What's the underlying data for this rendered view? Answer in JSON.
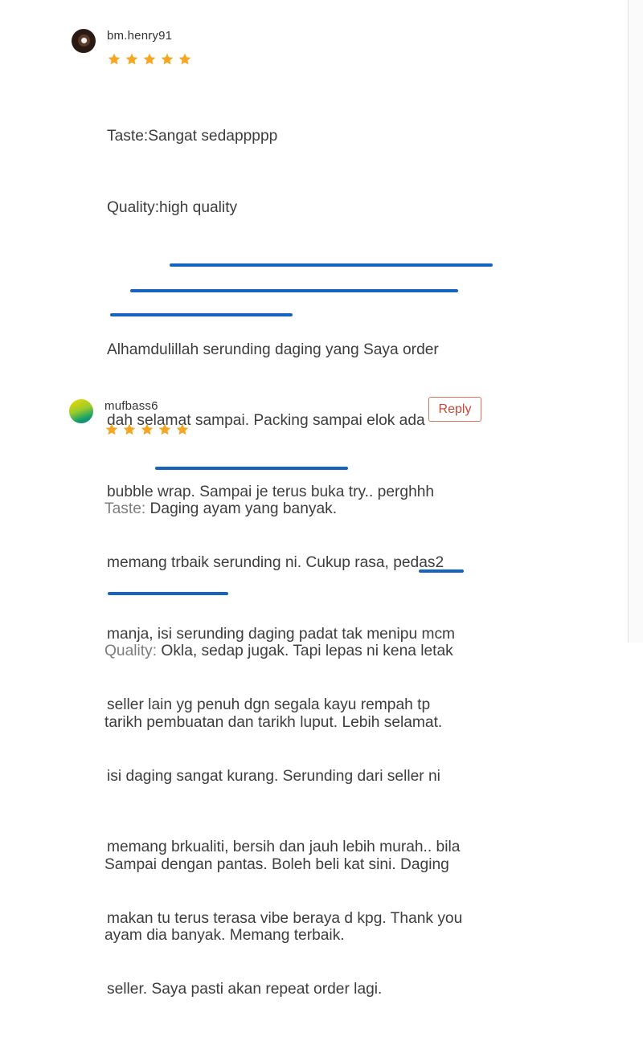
{
  "reviews": [
    {
      "username": "bm.henry91",
      "rating": 5,
      "lines": [
        "Taste:Sangat sedappppp",
        "Quality:high quality",
        "",
        "Alhamdulillah serunding daging yang Saya order",
        "dah selamat sampai. Packing sampai elok ada",
        "bubble wrap. Sampai je terus buka try.. perghhh",
        "memang trbaik serunding ni. Cukup rasa, pedas2",
        "manja, isi serunding daging padat tak menipu mcm",
        "seller lain yg penuh dgn segala kayu rempah tp",
        "isi daging sangat kurang. Serunding dari seller ni",
        "memang brkualiti, bersih dan jauh lebih murah.. bila",
        "makan tu terus terasa vibe beraya d kpg. Thank you",
        "seller. Saya pasti akan repeat order lagi."
      ]
    },
    {
      "username": "mufbass6",
      "rating": 5,
      "reply_label": "Reply",
      "taste_label": "Taste:",
      "taste_value": "Daging ayam yang banyak.",
      "quality_label": "Quality:",
      "quality_value_line1": "Okla, sedap jugak. Tapi lepas ni kena letak",
      "quality_value_line2": "tarikh pembuatan dan tarikh luput. Lebih selamat.",
      "body_line1": "Sampai dengan pantas. Boleh beli kat sini. Daging",
      "body_line2": "ayam dia banyak. Memang terbaik."
    }
  ],
  "colors": {
    "star": "#f5a623",
    "highlight": "#1565c0",
    "reply": "#c4473a"
  },
  "icons": [
    "star-icon"
  ]
}
